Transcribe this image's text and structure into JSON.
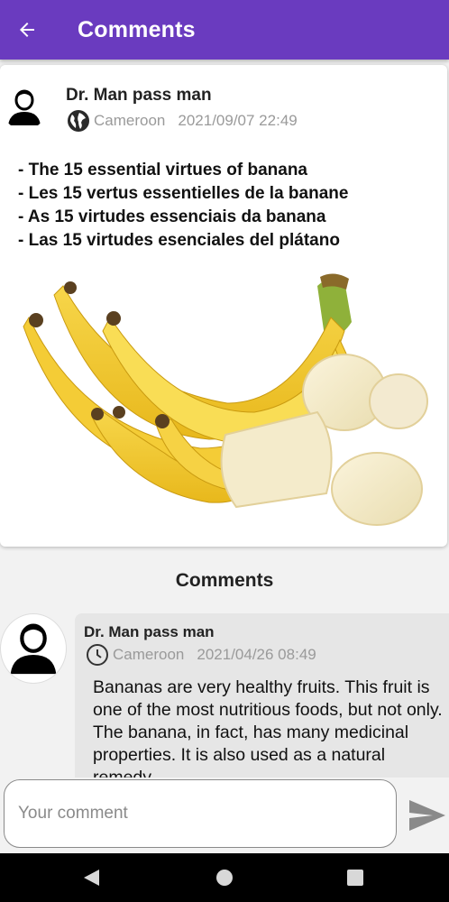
{
  "app_bar": {
    "title": "Comments",
    "back_icon": "arrow-left-icon",
    "color": "#6a3bbf"
  },
  "post": {
    "author": "Dr. Man pass man",
    "country": "Cameroon",
    "date": "2021/09/07 22:49",
    "location_icon": "globe-icon",
    "lines": [
      "- The 15 essential virtues of banana",
      "- Les 15 vertus essentielles de la banane",
      "- As 15 virtudes essenciais da banana",
      "- Las 15 virtudes esenciales del plátano"
    ],
    "image_icon": "banana-photo"
  },
  "comments_section": {
    "title": "Comments",
    "items": [
      {
        "author": "Dr. Man pass man",
        "country": "Cameroon",
        "date": "2021/04/26 08:49",
        "time_icon": "clock-icon",
        "text": "Bananas are very healthy fruits. This fruit is one of the most nutritious foods, but not only. The banana, in fact, has many medicinal properties. It is also used as a natural remedy."
      }
    ]
  },
  "composer": {
    "placeholder": "Your comment",
    "send_icon": "send-icon"
  },
  "system_nav": {
    "icons": [
      "nav-back-icon",
      "nav-home-icon",
      "nav-recents-icon"
    ]
  }
}
